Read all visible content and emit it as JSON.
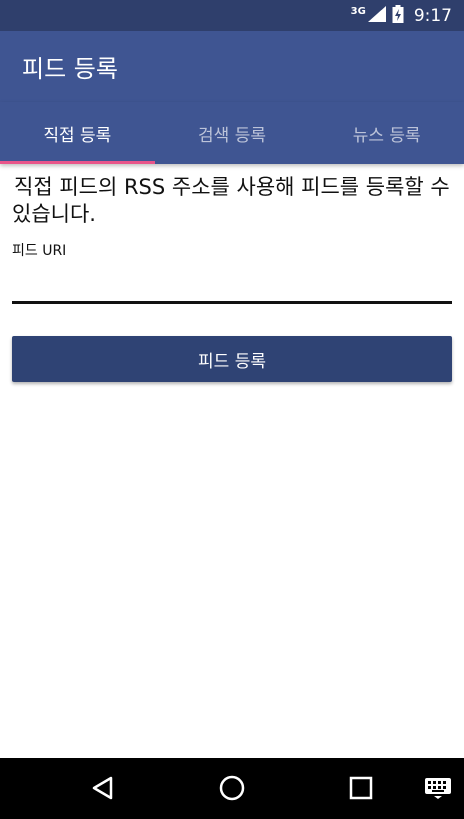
{
  "status_bar": {
    "network": "3G",
    "time": "9:17"
  },
  "app_bar": {
    "title": "피드 등록"
  },
  "tabs": [
    {
      "label": "직접 등록",
      "active": true
    },
    {
      "label": "검색 등록",
      "active": false
    },
    {
      "label": "뉴스 등록",
      "active": false
    }
  ],
  "main": {
    "description": "직접 피드의 RSS 주소를 사용해 피드를 등록할 수 있습니다.",
    "field_label": "피드 URI",
    "field_value": "",
    "submit_label": "피드 등록"
  },
  "colors": {
    "status_bar": "#2f3f6c",
    "app_bar": "#3f5592",
    "tab_indicator": "#e8558a",
    "button": "#2f4374"
  },
  "nav_bar": {
    "icons": [
      "back-icon",
      "home-icon",
      "recents-icon",
      "keyboard-icon"
    ]
  }
}
